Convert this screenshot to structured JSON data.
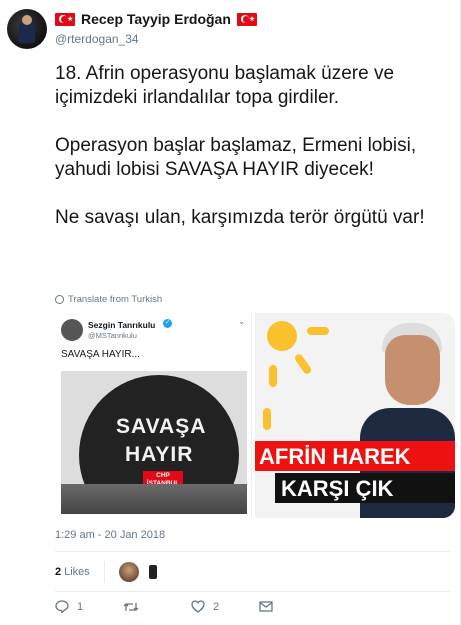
{
  "author": {
    "display_name": "Recep Tayyip Erdoğan",
    "handle": "@rterdogan_34"
  },
  "tweet": {
    "paragraphs": [
      "18. Afrin operasyonu başlamak üzere ve içimizdeki irlandalılar topa girdiler.",
      "Operasyon başlar başlamaz, Ermeni lobisi, yahudi lobisi SAVAŞA HAYIR diyecek!",
      "Ne savaşı ulan, karşımızda terör örgütü var!"
    ],
    "translate_label": "Translate from Turkish",
    "timestamp": "1:29 am - 20 Jan 2018"
  },
  "media": {
    "embedded_tweet": {
      "name": "Sezgin Tanrıkulu",
      "handle": "@MSTanrikulu",
      "text": "SAVAŞA HAYIR...",
      "sign_line1": "SAVAŞA",
      "sign_line2": "HAYIR",
      "badge_line1": "CHP",
      "badge_line2": "İSTANBUL"
    },
    "news_image": {
      "headline_line1": "AFRİN HAREK",
      "headline_line2": "KARŞI ÇIK"
    }
  },
  "stats": {
    "likes_count": "2",
    "likes_label": "Likes"
  },
  "actions": {
    "reply_count": "1",
    "retweet_count": "",
    "like_count": "2"
  },
  "colors": {
    "flag_red": "#e30a17",
    "muted_text": "#657786",
    "verified_blue": "#1da1f2"
  }
}
